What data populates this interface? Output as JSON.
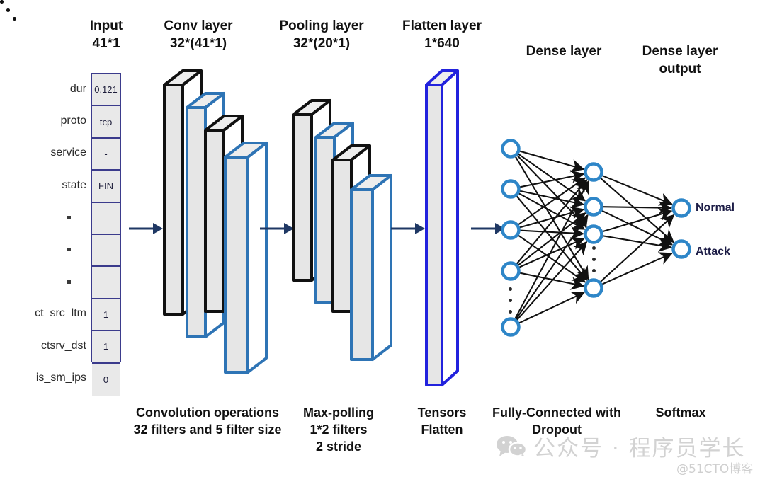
{
  "figure": {
    "title": "CNN intrusion-detection architecture diagram",
    "accent_blue": "#2E74B5",
    "slab_black": "#111111",
    "slab_fill": "#E5E5E5",
    "node_blue": "#2E86C8",
    "navy": "#1D1D47",
    "arrow_navy": "#1F3864"
  },
  "headers": {
    "input": "Input\n41*1",
    "conv": "Conv layer\n32*(41*1)",
    "pool": "Pooling layer\n32*(20*1)",
    "flatten": "Flatten layer\n1*640",
    "dense": "Dense layer",
    "dense_output": "Dense layer\noutput"
  },
  "captions": {
    "conv": "Convolution operations\n32 filters and 5 filter size",
    "pool": "Max-polling\n1*2 filters\n2 stride",
    "flatten": "Tensors\nFlatten",
    "dense": "Fully-Connected with\nDropout",
    "output": "Softmax"
  },
  "input_features": [
    {
      "label": "dur",
      "value": "0.121"
    },
    {
      "label": "proto",
      "value": "tcp"
    },
    {
      "label": "service",
      "value": "-"
    },
    {
      "label": "state",
      "value": "FIN"
    },
    {
      "label": "▪",
      "value": ""
    },
    {
      "label": "▪",
      "value": ""
    },
    {
      "label": "▪",
      "value": ""
    },
    {
      "label": "ct_src_ltm",
      "value": "1"
    },
    {
      "label": "ctsrv_dst",
      "value": "1"
    },
    {
      "label": "is_sm_ips",
      "value": "0"
    }
  ],
  "output_nodes": [
    {
      "label": "Normal"
    },
    {
      "label": "Attack"
    }
  ],
  "network": {
    "dense_input_node_count": 5,
    "dense_hidden_node_count": 4,
    "output_node_count": 2
  },
  "stacks": {
    "conv_slab_count": 4,
    "pool_slab_count": 4,
    "flatten_slab_count": 1
  },
  "watermark": {
    "main": "公众号 · 程序员学长",
    "sub": "@51CTO博客"
  }
}
